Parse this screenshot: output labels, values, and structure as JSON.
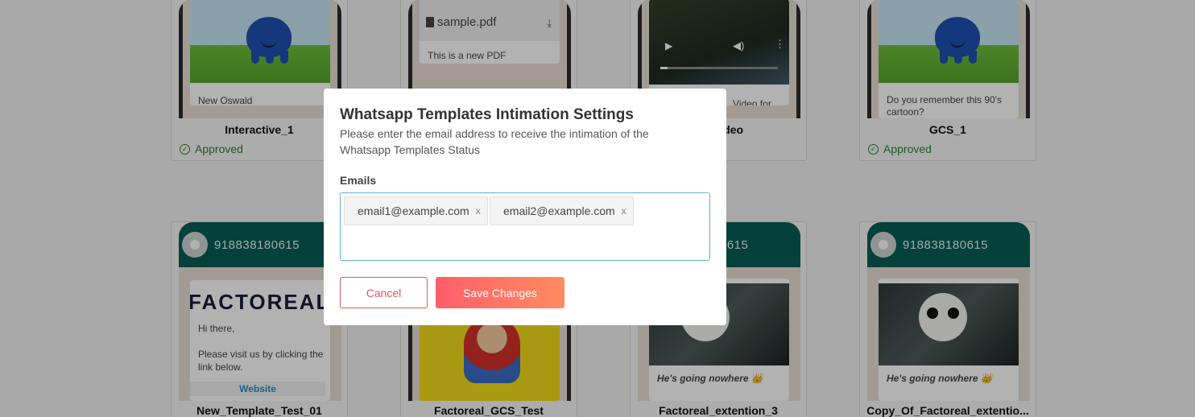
{
  "row1": [
    {
      "message": "New Oswald",
      "title": "Interactive_1",
      "status": "Approved",
      "show_status": true
    },
    {
      "file_name": "sample.pdf",
      "message": "This is a new PDF",
      "title": "",
      "show_status": false
    },
    {
      "message": "Video for",
      "title": "deo",
      "show_status": false
    },
    {
      "message": "Do you remember this 90's cartoon?",
      "title": "GCS_1",
      "status": "Approved",
      "show_status": true
    }
  ],
  "row2": [
    {
      "phone": "918838180615",
      "logo_text": "FACTOREAL",
      "message": "Hi there,\n\nPlease visit us by clicking the link below.",
      "button": "Website",
      "title": "New_Template_Test_01"
    },
    {
      "title": "Factoreal_GCS_Test"
    },
    {
      "phone": "0615",
      "caption": "He's going nowhere 👑",
      "title": "Factoreal_extention_3"
    },
    {
      "phone": "918838180615",
      "caption": "He's going nowhere 👑",
      "title": "Copy_Of_Factoreal_extentio..."
    }
  ],
  "modal": {
    "title": "Whatsapp Templates Intimation Settings",
    "description": "Please enter the email address to receive the intimation of the Whatsapp Templates Status",
    "emails_label": "Emails",
    "emails": [
      "email1@example.com",
      "email2@example.com"
    ],
    "remove_symbol": "x",
    "cancel_label": "Cancel",
    "save_label": "Save Changes"
  },
  "colors": {
    "wa_header": "#075e54",
    "approved": "#2e7d32",
    "accent_start": "#ff5e6a",
    "accent_end": "#ff8c60",
    "input_border": "#5fb7c8"
  }
}
